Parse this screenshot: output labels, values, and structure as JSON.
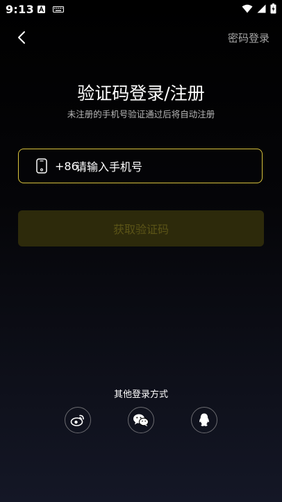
{
  "status_bar": {
    "time": "9:13"
  },
  "header": {
    "password_login_label": "密码登录"
  },
  "main": {
    "title": "验证码登录/注册",
    "subtitle": "未注册的手机号验证通过后将自动注册",
    "phone_prefix": "+86",
    "phone_placeholder": "请输入手机号",
    "phone_value": "",
    "get_code_label": "获取验证码"
  },
  "other_login": {
    "label": "其他登录方式",
    "options": [
      "weibo-icon",
      "wechat-icon",
      "qq-icon"
    ]
  },
  "colors": {
    "accent_border": "#d9c33c",
    "button_bg_disabled": "#2d2a0b",
    "button_text_disabled": "#5b5417"
  }
}
